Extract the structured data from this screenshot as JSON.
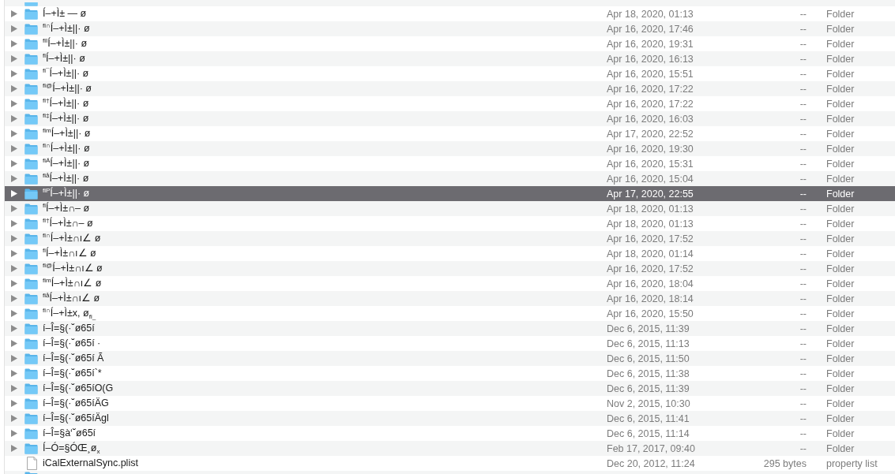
{
  "row_above": {
    "kind": "folder"
  },
  "rows": [
    {
      "kind": "folder",
      "expanded": false,
      "selected": false,
      "column_1": "Í–+Ì± — ø",
      "column_2": "Apr 18, 2020, 01:13",
      "column_3": "--",
      "column_4": "Folder"
    },
    {
      "kind": "folder",
      "expanded": false,
      "selected": false,
      "column_1": "$^{ﬁ∩}$Í–+Ì±||· ø",
      "column_2": "Apr 16, 2020, 17:46",
      "column_3": "--",
      "column_4": "Folder"
    },
    {
      "kind": "folder",
      "expanded": false,
      "selected": false,
      "column_1": "$^{ﬁî}$Í–+Ì±||· ø",
      "column_2": "Apr 16, 2020, 19:31",
      "column_3": "--",
      "column_4": "Folder"
    },
    {
      "kind": "folder",
      "expanded": false,
      "selected": false,
      "column_1": "$^{ﬁ}$Í–+Ì±||· ø",
      "column_2": "Apr 16, 2020, 16:13",
      "column_3": "--",
      "column_4": "Folder"
    },
    {
      "kind": "folder",
      "expanded": false,
      "selected": false,
      "column_1": "$^{ﬁ¯}$Í–+Ì±||· ø",
      "column_2": "Apr 16, 2020, 15:51",
      "column_3": "--",
      "column_4": "Folder"
    },
    {
      "kind": "folder",
      "expanded": false,
      "selected": false,
      "column_1": "$^{ﬁ@}$Í–+Ì±||· ø",
      "column_2": "Apr 16, 2020, 17:22",
      "column_3": "--",
      "column_4": "Folder"
    },
    {
      "kind": "folder",
      "expanded": false,
      "selected": false,
      "column_1": "$^{ﬁ†}$Í–+Ì±||· ø",
      "column_2": "Apr 16, 2020, 17:22",
      "column_3": "--",
      "column_4": "Folder"
    },
    {
      "kind": "folder",
      "expanded": false,
      "selected": false,
      "column_1": "$^{ﬁ‡}$Í–+Ì±||· ø",
      "column_2": "Apr 16, 2020, 16:03",
      "column_3": "--",
      "column_4": "Folder"
    },
    {
      "kind": "folder",
      "expanded": false,
      "selected": false,
      "column_1": "$^{ﬁm}$Í–+Ì±||· ø",
      "column_2": "Apr 17, 2020, 22:52",
      "column_3": "--",
      "column_4": "Folder"
    },
    {
      "kind": "folder",
      "expanded": false,
      "selected": false,
      "column_1": "$^{ﬁ∩}$Í–+Ì±||· ø",
      "column_2": "Apr 16, 2020, 19:30",
      "column_3": "--",
      "column_4": "Folder"
    },
    {
      "kind": "folder",
      "expanded": false,
      "selected": false,
      "column_1": "$^{ﬁÄ}$Í–+Ì±||· ø",
      "column_2": "Apr 16, 2020, 15:31",
      "column_3": "--",
      "column_4": "Folder"
    },
    {
      "kind": "folder",
      "expanded": false,
      "selected": false,
      "column_1": "$^{ﬁå}$Í–+Ì±||· ø",
      "column_2": "Apr 16, 2020, 15:04",
      "column_3": "--",
      "column_4": "Folder"
    },
    {
      "kind": "folder",
      "expanded": false,
      "selected": true,
      "column_1": "$^{ﬁP}$Í–+Ì±||· ø",
      "column_2": "Apr 17, 2020, 22:55",
      "column_3": "--",
      "column_4": "Folder"
    },
    {
      "kind": "folder",
      "expanded": false,
      "selected": false,
      "column_1": "$^{ﬁ}$Í–+Ì±∩– ø",
      "column_2": "Apr 18, 2020, 01:13",
      "column_3": "--",
      "column_4": "Folder"
    },
    {
      "kind": "folder",
      "expanded": false,
      "selected": false,
      "column_1": "$^{ﬁ†}$Í–+Ì±∩– ø",
      "column_2": "Apr 18, 2020, 01:13",
      "column_3": "--",
      "column_4": "Folder"
    },
    {
      "kind": "folder",
      "expanded": false,
      "selected": false,
      "column_1": "$^{ﬁ∩}$Í–+Ì±∩ı∠ ø",
      "column_2": "Apr 16, 2020, 17:52",
      "column_3": "--",
      "column_4": "Folder"
    },
    {
      "kind": "folder",
      "expanded": false,
      "selected": false,
      "column_1": "$^{ﬁ}$Í–+Ì±∩ı∠ ø",
      "column_2": "Apr 18, 2020, 01:14",
      "column_3": "--",
      "column_4": "Folder"
    },
    {
      "kind": "folder",
      "expanded": false,
      "selected": false,
      "column_1": "$^{ﬁ@}$Í–+Ì±∩ı∠ ø",
      "column_2": "Apr 16, 2020, 17:52",
      "column_3": "--",
      "column_4": "Folder"
    },
    {
      "kind": "folder",
      "expanded": false,
      "selected": false,
      "column_1": "$^{ﬁm}$Í–+Ì±∩ı∠ ø",
      "column_2": "Apr 16, 2020, 18:04",
      "column_3": "--",
      "column_4": "Folder"
    },
    {
      "kind": "folder",
      "expanded": false,
      "selected": false,
      "column_1": "$^{ﬁå}$Í–+Ì±∩ı∠ ø",
      "column_2": "Apr 16, 2020, 18:14",
      "column_3": "--",
      "column_4": "Folder"
    },
    {
      "kind": "folder",
      "expanded": false,
      "selected": false,
      "column_1": "$^{ﬁ∩}$Í–+Ì±x, ø$_{ﬁ_}$",
      "column_2": "Apr 16, 2020, 15:50",
      "column_3": "--",
      "column_4": "Folder"
    },
    {
      "kind": "folder",
      "expanded": false,
      "selected": false,
      "column_1": "í–Î=§(·˘ø65í",
      "column_2": "Dec 6, 2015, 11:39",
      "column_3": "--",
      "column_4": "Folder"
    },
    {
      "kind": "folder",
      "expanded": false,
      "selected": false,
      "column_1": "í–Î=§(·˘ø65í ·",
      "column_2": "Dec 6, 2015, 11:13",
      "column_3": "--",
      "column_4": "Folder"
    },
    {
      "kind": "folder",
      "expanded": false,
      "selected": false,
      "column_1": "í–Î=§(·˘ø65í Ã",
      "column_2": "Dec 6, 2015, 11:50",
      "column_3": "--",
      "column_4": "Folder"
    },
    {
      "kind": "folder",
      "expanded": false,
      "selected": false,
      "column_1": "í–Î=§(·˘ø65í`*",
      "column_2": "Dec 6, 2015, 11:38",
      "column_3": "--",
      "column_4": "Folder"
    },
    {
      "kind": "folder",
      "expanded": false,
      "selected": false,
      "column_1": "í–Î=§(·˘ø65íO(G",
      "column_2": "Dec 6, 2015, 11:39",
      "column_3": "--",
      "column_4": "Folder"
    },
    {
      "kind": "folder",
      "expanded": false,
      "selected": false,
      "column_1": "í–Î=§(·˘ø65íÄG",
      "column_2": "Nov 2, 2015, 10:30",
      "column_3": "--",
      "column_4": "Folder"
    },
    {
      "kind": "folder",
      "expanded": false,
      "selected": false,
      "column_1": "í–Î=§(·˘ø65íÄgl",
      "column_2": "Dec 6, 2015, 11:41",
      "column_3": "--",
      "column_4": "Folder"
    },
    {
      "kind": "folder",
      "expanded": false,
      "selected": false,
      "column_1": "í–Î=§à‘˘ø65í",
      "column_2": "Dec 6, 2015, 11:14",
      "column_3": "--",
      "column_4": "Folder"
    },
    {
      "kind": "folder",
      "expanded": false,
      "selected": false,
      "column_1": "Í–Ó=§ÓŒ¸ø$_{x}$",
      "column_2": "Feb 17, 2017, 09:40",
      "column_3": "--",
      "column_4": "Folder"
    },
    {
      "kind": "file",
      "selected": false,
      "column_1": "iCalExternalSync.plist",
      "column_2": "Dec 20, 2012, 11:24",
      "column_3": "295 bytes",
      "column_4": "property list"
    }
  ],
  "row_below": {
    "kind": "folder"
  }
}
